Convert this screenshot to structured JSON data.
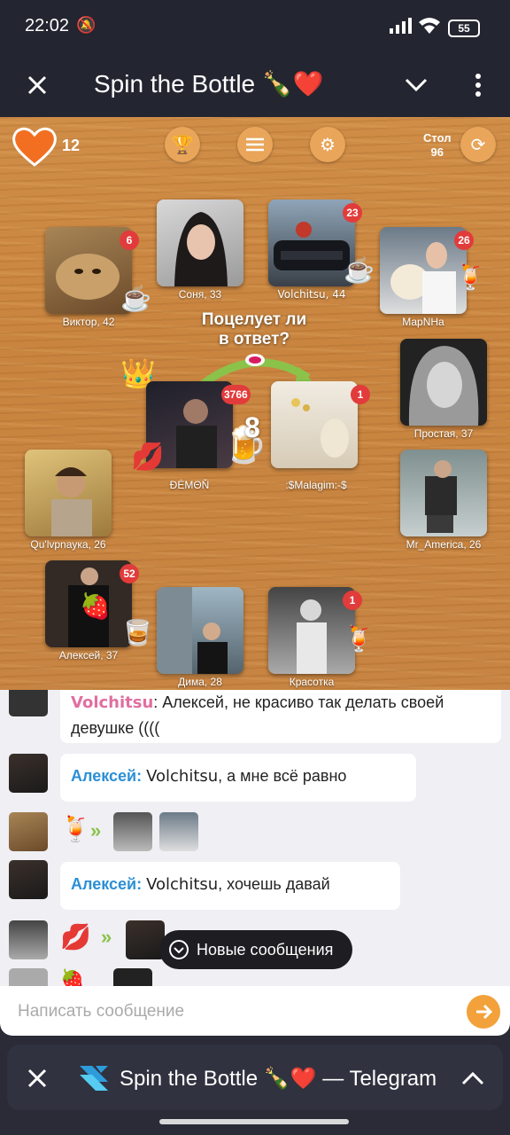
{
  "status_bar": {
    "time": "22:02",
    "battery": "55"
  },
  "title_bar": {
    "title": "Spin the Bottle 🍾❤️"
  },
  "game": {
    "hearts": "12",
    "table_label": "Стол",
    "table_number": "96",
    "prompt_line1": "Поцелует ли",
    "prompt_line2": "в ответ?",
    "countdown": "8",
    "players": [
      {
        "name": "Виктор, 42",
        "badge": "6"
      },
      {
        "name": "Соня, 33",
        "badge": ""
      },
      {
        "name": "Volchitsu, 44",
        "badge": "23"
      },
      {
        "name": "МарNНа",
        "badge": "26"
      },
      {
        "name": "Простая, 37",
        "badge": ""
      },
      {
        "name": "Mr_America, 26",
        "badge": ""
      },
      {
        "name": "Qu'lvрnayка, 26",
        "badge": ""
      },
      {
        "name": "Алексей, 37",
        "badge": "52"
      },
      {
        "name": "Дима, 28",
        "badge": ""
      },
      {
        "name": "Красотка",
        "badge": "1"
      }
    ],
    "center_left": {
      "name": "ĐĖMΘŇ",
      "badge": "3766"
    },
    "center_right": {
      "name": ":$Malagim:-$",
      "badge": "1"
    }
  },
  "chat": {
    "messages": [
      {
        "author": "Volchitsu",
        "text": ": Алексей, не красиво так делать своей девушке (((("
      },
      {
        "author": "Алексей:",
        "mention": "Volchitsu",
        "text": ", а мне всё равно"
      },
      {
        "author": "Алексей:",
        "mention": "Volchitsu",
        "text": ", хочешь давай"
      }
    ],
    "new_messages": "Новые сообщения",
    "placeholder": "Написать сообщение"
  },
  "bottom_bar": {
    "title": "Spin the Bottle 🍾❤️ — Telegram"
  }
}
